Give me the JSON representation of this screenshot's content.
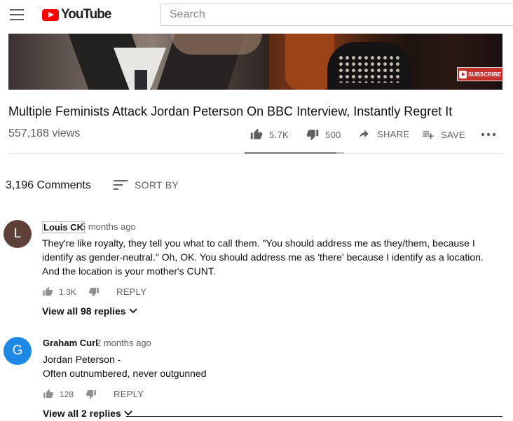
{
  "header": {
    "logo_text": "YouTube",
    "search_placeholder": "Search"
  },
  "video": {
    "subscribe_label": "SUBSCRIBE",
    "title": "Multiple Feminists Attack Jordan Peterson On BBC Interview, Instantly Regret It",
    "views": "557,188 views",
    "likes": "5.7K",
    "dislikes": "500",
    "share_label": "SHARE",
    "save_label": "SAVE",
    "like_ratio": 0.92
  },
  "comments_header": {
    "count": "3,196 Comments",
    "sort_label": "SORT BY"
  },
  "comments": [
    {
      "initial": "L",
      "avatar_color": "#5d4037",
      "author": "Louis CK",
      "time": "5 months ago",
      "text": "They're like royalty, they tell you what to call them. \"You should address me as they/them, because I identify as gender-neutral.\" Oh, OK. You should address me as 'there' because I identify as a location. And the location is your mother's CUNT.",
      "likes": "1.3K",
      "reply_label": "REPLY",
      "view_replies": "View all 98 replies"
    },
    {
      "initial": "G",
      "avatar_color": "#1e88e5",
      "author": "Graham Curl",
      "time": "2 months ago",
      "text_line1": "Jordan Peterson -",
      "text_line2": "Often outnumbered, never outgunned",
      "likes": "128",
      "reply_label": "REPLY",
      "view_replies": "View all 2 replies"
    }
  ],
  "icons": {
    "menu": "hamburger-menu-icon",
    "like": "thumbs-up-icon",
    "dislike": "thumbs-down-icon",
    "share": "share-arrow-icon",
    "save": "playlist-add-icon",
    "more": "more-horizontal-icon",
    "sort": "sort-icon",
    "expand": "chevron-down-icon"
  }
}
